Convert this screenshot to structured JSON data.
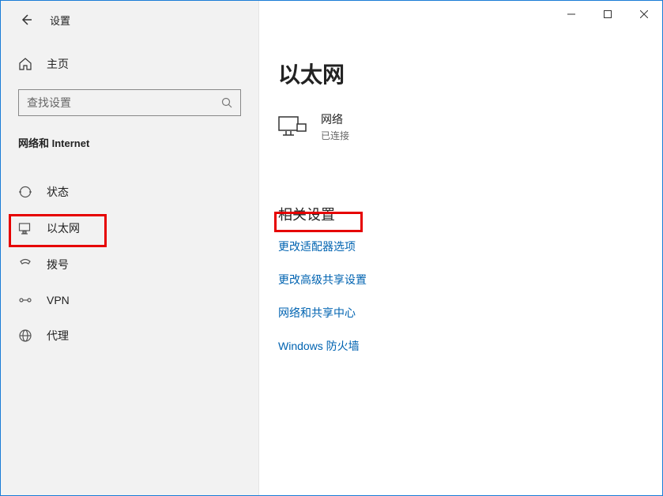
{
  "titlebar": {
    "app_title": "设置"
  },
  "sidebar": {
    "home_label": "主页",
    "search_placeholder": "查找设置",
    "category_title": "网络和 Internet",
    "items": [
      {
        "label": "状态"
      },
      {
        "label": "以太网"
      },
      {
        "label": "拨号"
      },
      {
        "label": "VPN"
      },
      {
        "label": "代理"
      }
    ]
  },
  "main": {
    "page_title": "以太网",
    "connection": {
      "name": "网络",
      "status": "已连接"
    },
    "related_title": "相关设置",
    "links": [
      {
        "label": "更改适配器选项"
      },
      {
        "label": "更改高级共享设置"
      },
      {
        "label": "网络和共享中心"
      },
      {
        "label": "Windows 防火墙"
      }
    ]
  }
}
